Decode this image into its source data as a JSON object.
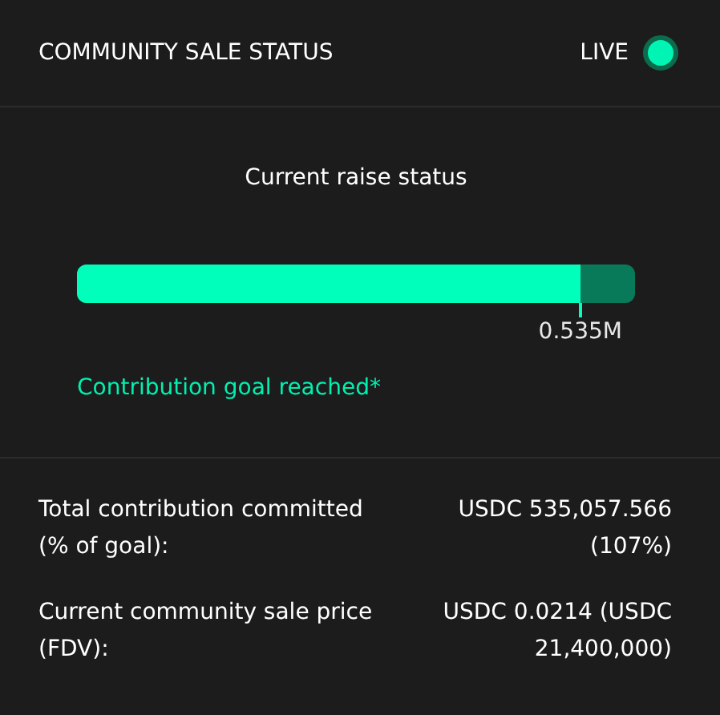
{
  "header": {
    "title": "COMMUNITY SALE STATUS",
    "status": {
      "label": "LIVE",
      "on": true
    }
  },
  "raise": {
    "title": "Current raise status",
    "progress": {
      "level": 0.902,
      "reading": "0.535M"
    },
    "note": "Contribution goal reached*"
  },
  "details": [
    {
      "label": "Total contribution committed (% of goal):",
      "value": "USDC 535,057.566 (107%)"
    },
    {
      "label": "Current community sale price (FDV):",
      "value": "USDC 0.0214 (USDC 21,400,000)"
    }
  ]
}
